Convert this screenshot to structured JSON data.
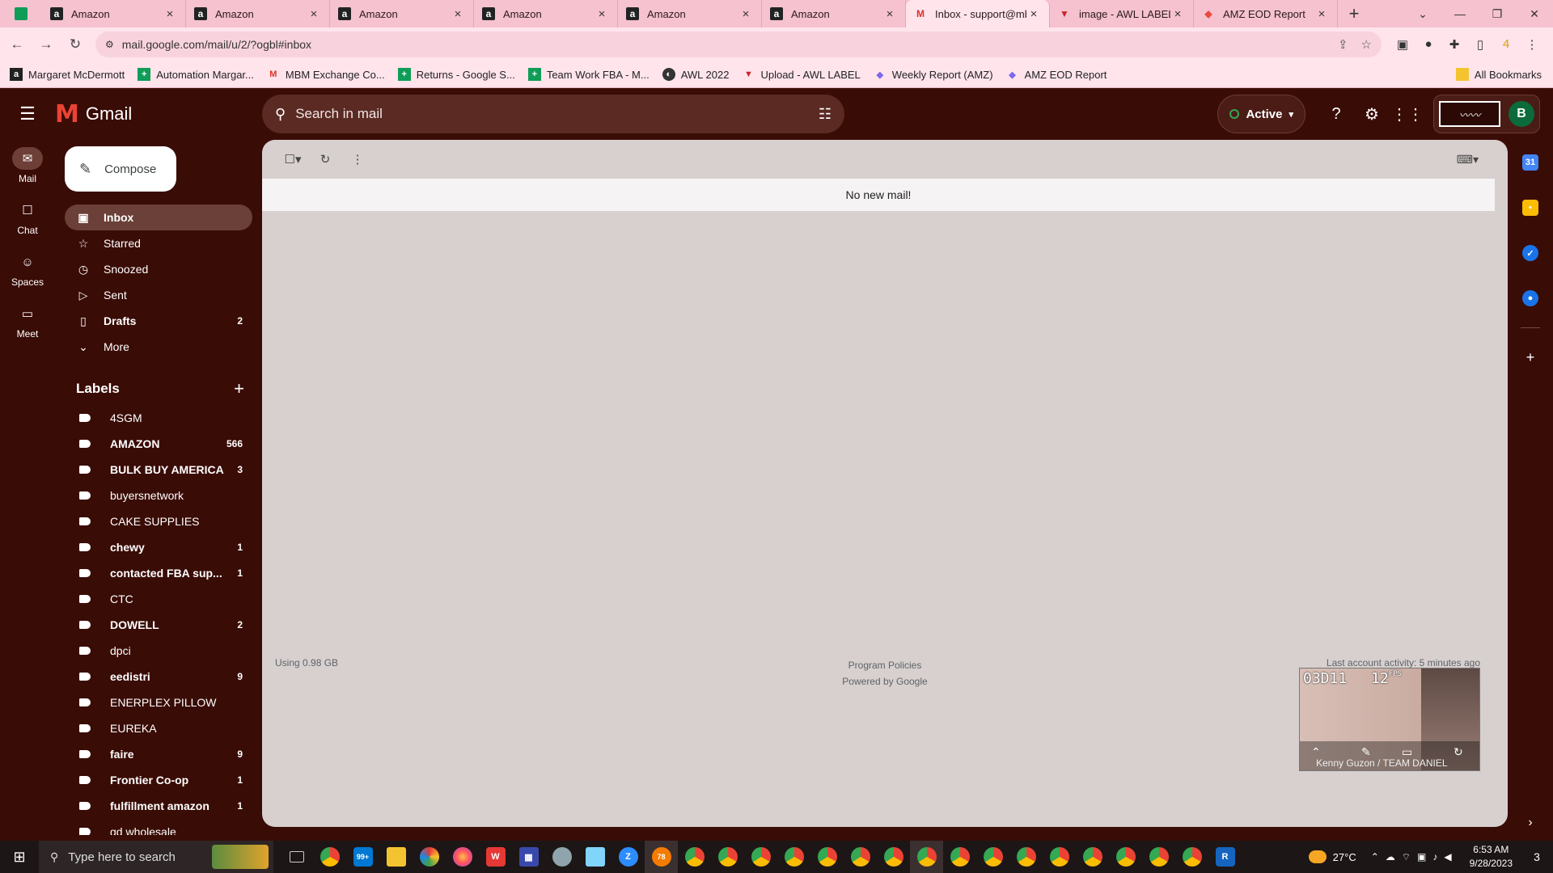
{
  "tabs": [
    {
      "label": "Amazon",
      "icon": "amazon-icon"
    },
    {
      "label": "Amazon",
      "icon": "amazon-icon"
    },
    {
      "label": "Amazon",
      "icon": "amazon-icon"
    },
    {
      "label": "Amazon",
      "icon": "amazon-icon"
    },
    {
      "label": "Amazon",
      "icon": "amazon-icon"
    },
    {
      "label": "Amazon",
      "icon": "amazon-icon"
    },
    {
      "label": "Inbox - support@mb",
      "icon": "gmail-icon",
      "active": true
    },
    {
      "label": "image - AWL LABEL",
      "icon": "awl-icon"
    },
    {
      "label": "AMZ EOD Report",
      "icon": "clickup-icon"
    }
  ],
  "address": {
    "url": "mail.google.com/mail/u/2/?ogbl#inbox"
  },
  "bookmarks": [
    {
      "label": "Margaret McDermott",
      "icon": "amazon-icon"
    },
    {
      "label": "Automation Margar...",
      "icon": "sheets-icon"
    },
    {
      "label": "MBM Exchange Co...",
      "icon": "gmail-icon"
    },
    {
      "label": "Returns - Google S...",
      "icon": "sheets-icon"
    },
    {
      "label": "Team Work FBA - M...",
      "icon": "sheets-icon"
    },
    {
      "label": "AWL 2022",
      "icon": "globe-icon"
    },
    {
      "label": "Upload - AWL LABEL",
      "icon": "awl-icon"
    },
    {
      "label": "Weekly Report (AMZ)",
      "icon": "clickup-icon"
    },
    {
      "label": "AMZ EOD Report",
      "icon": "clickup-icon"
    }
  ],
  "all_bookmarks": "All Bookmarks",
  "gmail": {
    "logo_text": "Gmail",
    "search_placeholder": "Search in mail",
    "status": "Active",
    "account_initial": "B",
    "compose": "Compose",
    "rail": [
      {
        "label": "Mail",
        "icon": "mail-icon",
        "selected": true
      },
      {
        "label": "Chat",
        "icon": "chat-icon"
      },
      {
        "label": "Spaces",
        "icon": "spaces-icon"
      },
      {
        "label": "Meet",
        "icon": "meet-icon"
      }
    ],
    "folders": [
      {
        "label": "Inbox",
        "icon": "inbox-icon",
        "count": "",
        "selected": true
      },
      {
        "label": "Starred",
        "icon": "star-icon",
        "count": ""
      },
      {
        "label": "Snoozed",
        "icon": "clock-icon",
        "count": ""
      },
      {
        "label": "Sent",
        "icon": "send-icon",
        "count": ""
      },
      {
        "label": "Drafts",
        "icon": "draft-icon",
        "count": "2",
        "bold": true
      },
      {
        "label": "More",
        "icon": "chevron-down-icon",
        "count": ""
      }
    ],
    "labels_title": "Labels",
    "labels": [
      {
        "name": "4SGM",
        "count": "",
        "bold": false
      },
      {
        "name": "AMAZON",
        "count": "566",
        "bold": true
      },
      {
        "name": "BULK BUY AMERICA",
        "count": "3",
        "bold": true
      },
      {
        "name": "buyersnetwork",
        "count": "",
        "bold": false
      },
      {
        "name": "CAKE SUPPLIES",
        "count": "",
        "bold": false
      },
      {
        "name": "chewy",
        "count": "1",
        "bold": true
      },
      {
        "name": "contacted FBA sup...",
        "count": "1",
        "bold": true
      },
      {
        "name": "CTC",
        "count": "",
        "bold": false
      },
      {
        "name": "DOWELL",
        "count": "2",
        "bold": true
      },
      {
        "name": "dpci",
        "count": "",
        "bold": false
      },
      {
        "name": "eedistri",
        "count": "9",
        "bold": true
      },
      {
        "name": "ENERPLEX PILLOW",
        "count": "",
        "bold": false
      },
      {
        "name": "EUREKA",
        "count": "",
        "bold": false
      },
      {
        "name": "faire",
        "count": "9",
        "bold": true
      },
      {
        "name": "Frontier Co-op",
        "count": "1",
        "bold": true
      },
      {
        "name": "fulfillment amazon",
        "count": "1",
        "bold": true
      },
      {
        "name": "gd wholesale",
        "count": "",
        "bold": false
      }
    ],
    "empty_message": "No new mail!",
    "storage": "Using 0.98 GB",
    "program_policies": "Program Policies",
    "powered_by": "Powered by Google",
    "last_activity": "Last account activity: 5 minutes ago"
  },
  "video": {
    "timecode": "03D11",
    "fps": "12",
    "fps_unit": "FPS",
    "caller": "Kenny Guzon / TEAM DANIEL"
  },
  "taskbar": {
    "search_placeholder": "Type here to search",
    "temperature": "27°C",
    "time": "6:53 AM",
    "date": "9/28/2023",
    "notifications": "3",
    "mail_badge": "99+",
    "app_badge": "78"
  },
  "colors": {
    "tab_strip": "#f6c2d0",
    "gmail_bg": "#3a0c06",
    "main_panel": "#d7d0cf",
    "accent_red": "#ea4335"
  }
}
